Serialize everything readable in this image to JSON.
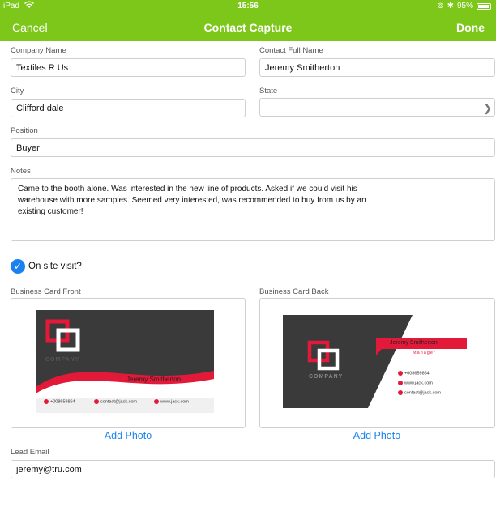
{
  "status": {
    "carrier": "iPad",
    "time": "15:56",
    "battery": "95%",
    "battery_level": 0.95
  },
  "nav": {
    "cancel": "Cancel",
    "title": "Contact Capture",
    "done": "Done"
  },
  "form": {
    "company_label": "Company Name",
    "company_value": "Textiles R Us",
    "fullname_label": "Contact Full Name",
    "fullname_value": "Jeremy Smitherton",
    "city_label": "City",
    "city_value": "Clifford dale",
    "state_label": "State",
    "state_value": "",
    "position_label": "Position",
    "position_value": "Buyer",
    "notes_label": "Notes",
    "notes_value": "Came to the booth alone. Was interested in the new line of products. Asked if we could visit his warehouse with more samples. Seemed very interested, was recommended to buy from us by an existing customer!",
    "onsite_label": "On site visit?",
    "onsite_checked": true,
    "card_front_label": "Business Card Front",
    "card_back_label": "Business Card Back",
    "add_photo": "Add Photo",
    "lead_email_label": "Lead Email",
    "lead_email_value": "jeremy@tru.com"
  },
  "card_front": {
    "company": "COMPANY",
    "name": "Jeremy Smitherton",
    "phone": "+008659864",
    "email": "contact@jack.com",
    "web": "www.jack.com"
  },
  "card_back": {
    "company": "COMPANY",
    "name": "Jeremy Smitherton",
    "role": "Manager",
    "phone": "+008659864",
    "web": "www.jack.com",
    "email": "contact@jack.com"
  },
  "colors": {
    "accent": "#7cc719",
    "link": "#1a82f0",
    "card_red": "#e3193a",
    "card_dark": "#3a3a3a"
  }
}
